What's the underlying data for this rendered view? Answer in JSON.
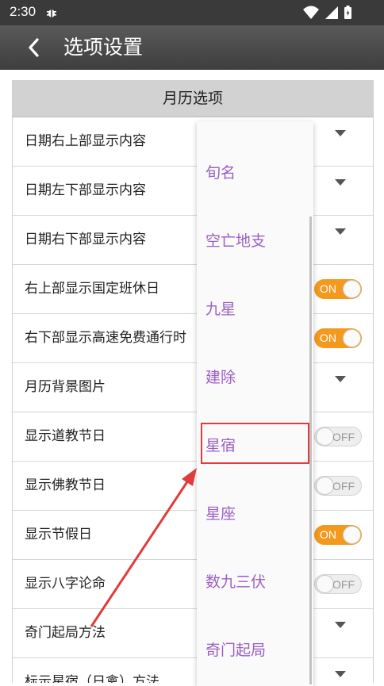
{
  "status": {
    "time": "2:30"
  },
  "header": {
    "title": "选项设置"
  },
  "section": {
    "title": "月历选项"
  },
  "rows": [
    {
      "label": "日期右上部显示内容",
      "control": "dropdown"
    },
    {
      "label": "日期左下部显示内容",
      "control": "dropdown"
    },
    {
      "label": "日期右下部显示内容",
      "control": "dropdown"
    },
    {
      "label": "右上部显示国定班休日",
      "control": "toggle",
      "state": "ON"
    },
    {
      "label": "右下部显示高速免费通行时",
      "control": "toggle",
      "state": "ON"
    },
    {
      "label": "月历背景图片",
      "control": "dropdown"
    },
    {
      "label": "显示道教节日",
      "control": "toggle",
      "state": "OFF"
    },
    {
      "label": "显示佛教节日",
      "control": "toggle",
      "state": "OFF"
    },
    {
      "label": "显示节假日",
      "control": "toggle",
      "state": "ON"
    },
    {
      "label": "显示八字论命",
      "control": "toggle",
      "state": "OFF"
    },
    {
      "label": "奇门起局方法",
      "control": "dropdown"
    },
    {
      "label": "标示星宿（日禽）方法",
      "control": "dropdown"
    }
  ],
  "dropdown": {
    "options": [
      "旬名",
      "空亡地支",
      "九星",
      "建除",
      "星宿",
      "星座",
      "数九三伏",
      "奇门起局"
    ],
    "highlighted": "星宿"
  },
  "colors": {
    "accent_on": "#f39a1e",
    "option_text": "#9c5fc2",
    "annotation": "#e13b3b",
    "appbar": "#4a4a4a"
  }
}
